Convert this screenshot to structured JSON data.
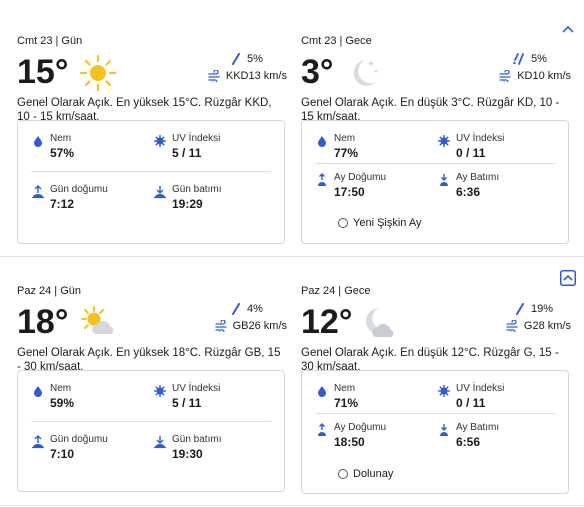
{
  "days": [
    {
      "day": {
        "header": "Cmt 23 | Gün",
        "temp": "15°",
        "icon": "sun-icon",
        "precip": "5%",
        "wind": "KKD13 km/s",
        "description": "Genel Olarak Açık. En yüksek 15°C. Rüzgâr KKD, 10 - 15 km/saat.",
        "stats": [
          {
            "label": "Nem",
            "value": "57%",
            "icon": "humidity-icon"
          },
          {
            "label": "UV İndeksi",
            "value": "5 / 11",
            "icon": "uv-icon"
          },
          {
            "label": "Gün doğumu",
            "value": "7:12",
            "icon": "sunrise-icon"
          },
          {
            "label": "Gün batımı",
            "value": "19:29",
            "icon": "sunset-icon"
          }
        ]
      },
      "night": {
        "header": "Cmt 23 | Gece",
        "temp": "3°",
        "icon": "moon-clear-icon",
        "precip": "5%",
        "wind": "KD10 km/s",
        "description": "Genel Olarak Açık. En düşük 3°C. Rüzgâr KD, 10 - 15 km/saat.",
        "stats": [
          {
            "label": "Nem",
            "value": "77%",
            "icon": "humidity-icon"
          },
          {
            "label": "UV İndeksi",
            "value": "0 / 11",
            "icon": "uv-icon"
          },
          {
            "label": "Ay Doğumu",
            "value": "17:50",
            "icon": "moonrise-icon"
          },
          {
            "label": "Ay Batımı",
            "value": "6:36",
            "icon": "moonset-icon"
          }
        ],
        "moon_phase": "Yeni Şişkin Ay"
      }
    },
    {
      "day": {
        "header": "Paz 24 | Gün",
        "temp": "18°",
        "icon": "partly-cloudy-day-icon",
        "precip": "4%",
        "wind": "GB26 km/s",
        "description": "Genel Olarak Açık. En yüksek 18°C. Rüzgâr GB, 15 - 30 km/saat.",
        "stats": [
          {
            "label": "Nem",
            "value": "59%",
            "icon": "humidity-icon"
          },
          {
            "label": "UV İndeksi",
            "value": "5 / 11",
            "icon": "uv-icon"
          },
          {
            "label": "Gün doğumu",
            "value": "7:10",
            "icon": "sunrise-icon"
          },
          {
            "label": "Gün batımı",
            "value": "19:30",
            "icon": "sunset-icon"
          }
        ]
      },
      "night": {
        "header": "Paz 24 | Gece",
        "temp": "12°",
        "icon": "partly-cloudy-night-icon",
        "precip": "19%",
        "wind": "G28 km/s",
        "description": "Genel Olarak Açık. En düşük 12°C. Rüzgâr G, 15 - 30 km/saat.",
        "stats": [
          {
            "label": "Nem",
            "value": "71%",
            "icon": "humidity-icon"
          },
          {
            "label": "UV İndeksi",
            "value": "0 / 11",
            "icon": "uv-icon"
          },
          {
            "label": "Ay Doğumu",
            "value": "18:50",
            "icon": "moonrise-icon"
          },
          {
            "label": "Ay Batımı",
            "value": "6:56",
            "icon": "moonset-icon"
          }
        ],
        "moon_phase": "Dolunay"
      }
    }
  ],
  "colors": {
    "accent": "#2f5cd8",
    "sun": "#f6c21a",
    "moon": "#d8dbe2",
    "cloud": "#d4d7dc"
  }
}
